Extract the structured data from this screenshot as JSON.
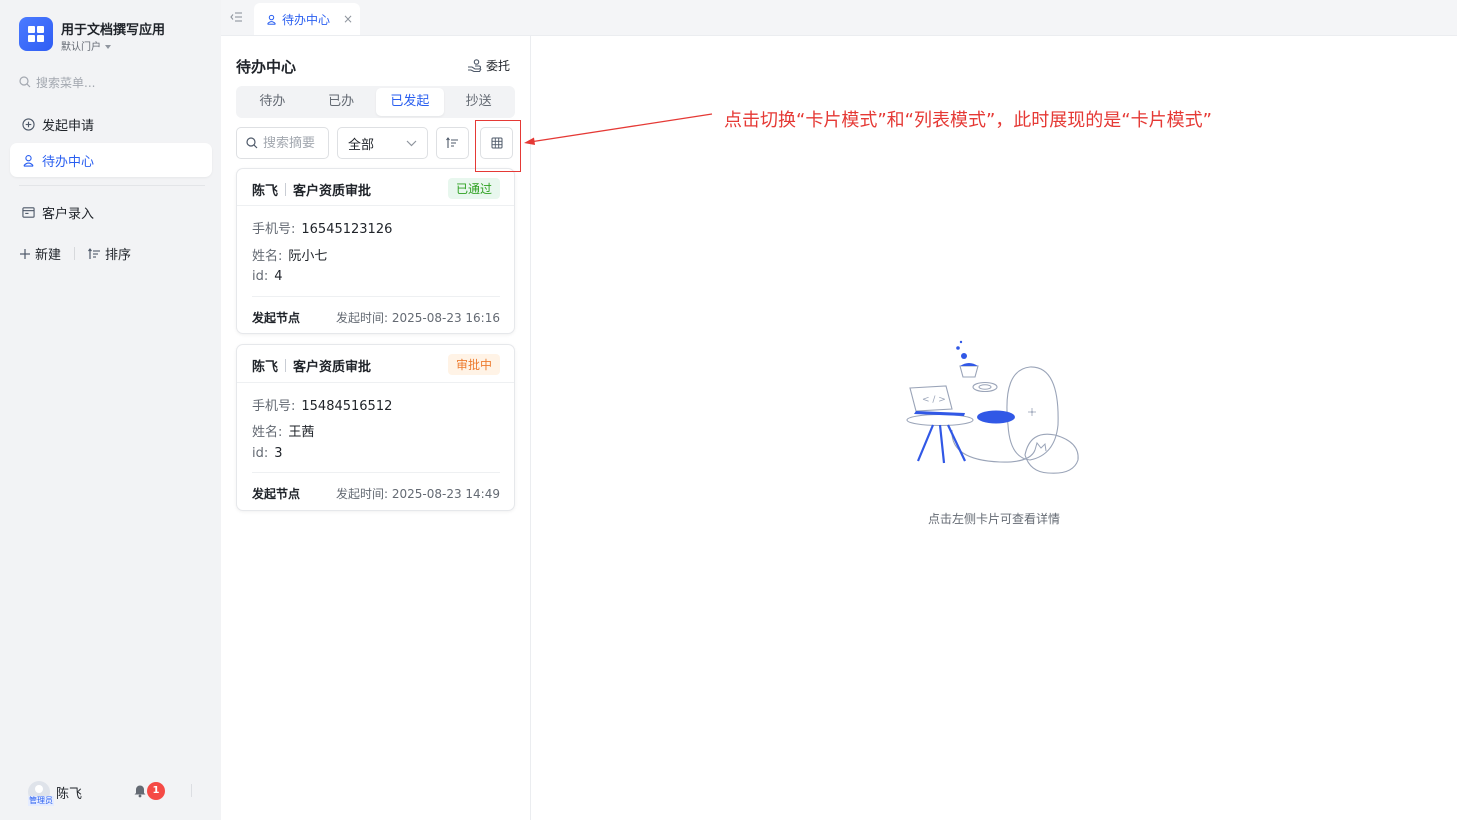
{
  "app": {
    "title": "用于文档撰写应用",
    "portal": "默认门户"
  },
  "sidebar": {
    "search_placeholder": "搜索菜单...",
    "items": [
      {
        "label": "发起申请"
      },
      {
        "label": "待办中心"
      },
      {
        "label": "客户录入"
      }
    ],
    "new_label": "新建",
    "sort_label": "排序"
  },
  "user": {
    "name": "陈飞",
    "role_badge": "管理员",
    "notifications": "1"
  },
  "tabbar": {
    "tab_label": "待办中心",
    "close": "×"
  },
  "panel": {
    "title": "待办中心",
    "delegate_label": "委托",
    "tabs": [
      {
        "label": "待办"
      },
      {
        "label": "已办"
      },
      {
        "label": "已发起"
      },
      {
        "label": "抄送"
      }
    ],
    "search_placeholder": "搜索摘要",
    "filter_value": "全部"
  },
  "cards": [
    {
      "initiator": "陈飞",
      "process": "客户资质审批",
      "status": "已通过",
      "fields": [
        {
          "key": "手机号:",
          "value": "16545123126"
        },
        {
          "key": "姓名:",
          "value": "阮小七"
        },
        {
          "key": "id:",
          "value": "4"
        }
      ],
      "node": "发起节点",
      "time": "发起时间: 2025-08-23 16:16"
    },
    {
      "initiator": "陈飞",
      "process": "客户资质审批",
      "status": "审批中",
      "fields": [
        {
          "key": "手机号:",
          "value": "15484516512"
        },
        {
          "key": "姓名:",
          "value": "王茜"
        },
        {
          "key": "id:",
          "value": "3"
        }
      ],
      "node": "发起节点",
      "time": "发起时间: 2025-08-23 14:49"
    }
  ],
  "detail": {
    "empty_text": "点击左侧卡片可查看详情"
  },
  "annotation": {
    "text": "点击切换“卡片模式”和“列表模式”，此时展现的是“卡片模式”"
  },
  "colors": {
    "accent": "#2a5ff0",
    "passed": "#2ea121",
    "pending": "#ed7b2f",
    "annotation": "#e53935"
  }
}
